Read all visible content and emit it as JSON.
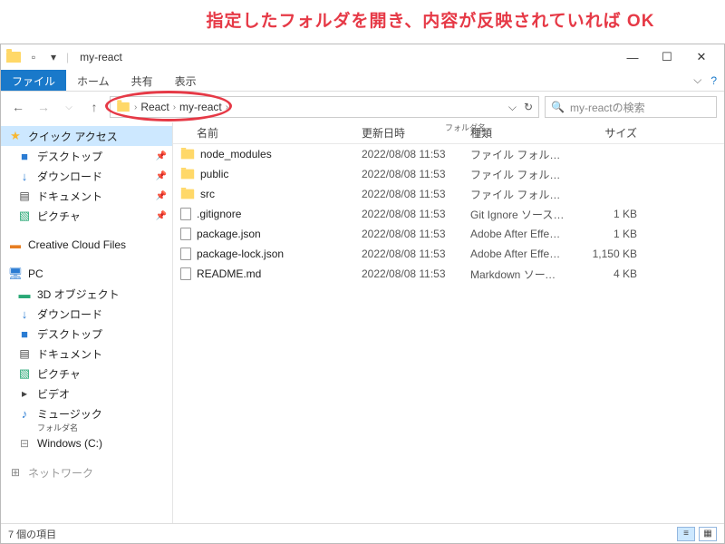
{
  "annotation": "指定したフォルダを開き、内容が反映されていれば OK",
  "title": "my-react",
  "ribbon": {
    "file": "ファイル",
    "home": "ホーム",
    "share": "共有",
    "view": "表示"
  },
  "breadcrumb": {
    "items": [
      "React",
      "my-react"
    ]
  },
  "search": {
    "placeholder": "my-reactの検索"
  },
  "sidebar": {
    "quick": {
      "label": "クイック アクセス",
      "items": [
        {
          "label": "デスクトップ",
          "pinned": true
        },
        {
          "label": "ダウンロード",
          "pinned": true
        },
        {
          "label": "ドキュメント",
          "pinned": true
        },
        {
          "label": "ピクチャ",
          "pinned": true
        }
      ]
    },
    "ccf": "Creative Cloud Files",
    "pc": {
      "label": "PC",
      "items": [
        "3D オブジェクト",
        "ダウンロード",
        "デスクトップ",
        "ドキュメント",
        "ピクチャ",
        "ビデオ",
        "ミュージック"
      ],
      "folder_label": "フォルダ名",
      "drive": "Windows (C:)"
    },
    "network": "ネットワーク"
  },
  "columns": {
    "name": "名前",
    "date": "更新日時",
    "type": "種類",
    "size": "サイズ",
    "group_label": "フォルダ名"
  },
  "files": [
    {
      "name": "node_modules",
      "date": "2022/08/08 11:53",
      "type": "ファイル フォルダー",
      "size": "",
      "kind": "folder"
    },
    {
      "name": "public",
      "date": "2022/08/08 11:53",
      "type": "ファイル フォルダー",
      "size": "",
      "kind": "folder"
    },
    {
      "name": "src",
      "date": "2022/08/08 11:53",
      "type": "ファイル フォルダー",
      "size": "",
      "kind": "folder"
    },
    {
      "name": ".gitignore",
      "date": "2022/08/08 11:53",
      "type": "Git Ignore ソース フ...",
      "size": "1 KB",
      "kind": "file"
    },
    {
      "name": "package.json",
      "date": "2022/08/08 11:53",
      "type": "Adobe After Effect...",
      "size": "1 KB",
      "kind": "file"
    },
    {
      "name": "package-lock.json",
      "date": "2022/08/08 11:53",
      "type": "Adobe After Effect...",
      "size": "1,150 KB",
      "kind": "file"
    },
    {
      "name": "README.md",
      "date": "2022/08/08 11:53",
      "type": "Markdown ソース フ...",
      "size": "4 KB",
      "kind": "file"
    }
  ],
  "status": {
    "count": "7 個の項目"
  }
}
